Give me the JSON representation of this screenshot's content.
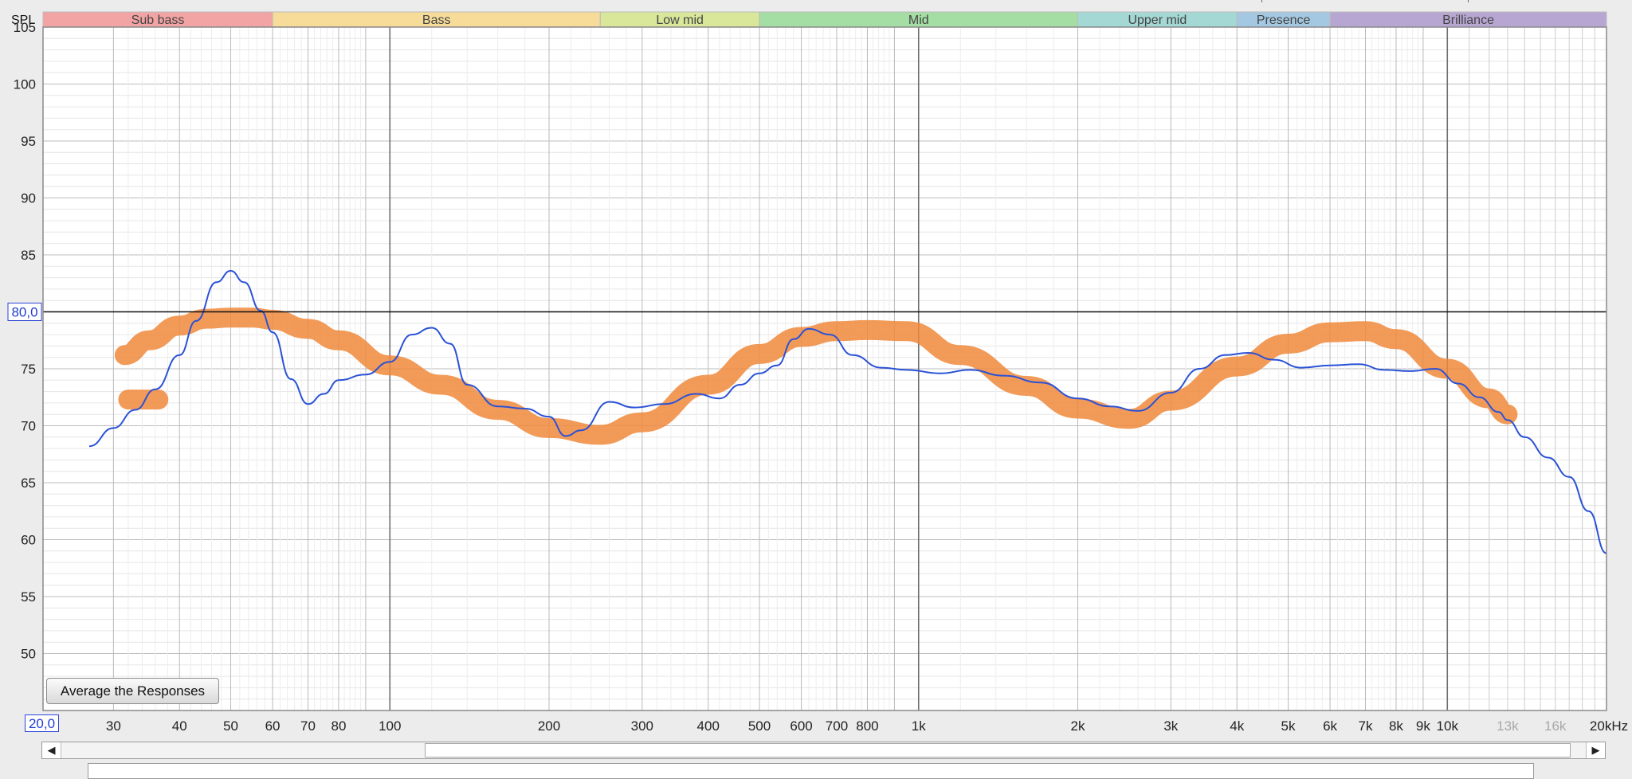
{
  "chart_data": {
    "type": "line",
    "title": "",
    "xlabel": "kHz",
    "ylabel": "SPL",
    "x_scale": "log",
    "xlim": [
      20,
      20000
    ],
    "ylim": [
      45,
      105
    ],
    "y_ticks": [
      50,
      55,
      60,
      65,
      70,
      75,
      80,
      85,
      90,
      95,
      100,
      105
    ],
    "x_ticks": [
      {
        "value": 30,
        "label": "30"
      },
      {
        "value": 40,
        "label": "40"
      },
      {
        "value": 50,
        "label": "50"
      },
      {
        "value": 60,
        "label": "60"
      },
      {
        "value": 70,
        "label": "70"
      },
      {
        "value": 80,
        "label": "80"
      },
      {
        "value": 100,
        "label": "100"
      },
      {
        "value": 200,
        "label": "200"
      },
      {
        "value": 300,
        "label": "300"
      },
      {
        "value": 400,
        "label": "400"
      },
      {
        "value": 500,
        "label": "500"
      },
      {
        "value": 600,
        "label": "600"
      },
      {
        "value": 700,
        "label": "700"
      },
      {
        "value": 800,
        "label": "800"
      },
      {
        "value": 1000,
        "label": "1k"
      },
      {
        "value": 2000,
        "label": "2k"
      },
      {
        "value": 3000,
        "label": "3k"
      },
      {
        "value": 4000,
        "label": "4k"
      },
      {
        "value": 5000,
        "label": "5k"
      },
      {
        "value": 6000,
        "label": "6k"
      },
      {
        "value": 7000,
        "label": "7k"
      },
      {
        "value": 8000,
        "label": "8k"
      },
      {
        "value": 9000,
        "label": "9k"
      },
      {
        "value": 10000,
        "label": "10k"
      },
      {
        "value": 13000,
        "label": "13k",
        "dim": true
      },
      {
        "value": 16000,
        "label": "16k",
        "dim": true
      },
      {
        "value": 20000,
        "label": "20kHz"
      }
    ],
    "bands": [
      {
        "name": "Sub bass",
        "from": 20,
        "to": 60,
        "color": "#f2a3a3"
      },
      {
        "name": "Bass",
        "from": 60,
        "to": 250,
        "color": "#f6dc98"
      },
      {
        "name": "Low mid",
        "from": 250,
        "to": 500,
        "color": "#d8e79a"
      },
      {
        "name": "Mid",
        "from": 500,
        "to": 2000,
        "color": "#a4dea4"
      },
      {
        "name": "Upper mid",
        "from": 2000,
        "to": 4000,
        "color": "#a4d8d4"
      },
      {
        "name": "Presence",
        "from": 4000,
        "to": 6000,
        "color": "#a4c8e2"
      },
      {
        "name": "Brilliance",
        "from": 6000,
        "to": 20000,
        "color": "#b8a6d2"
      }
    ],
    "cursor": {
      "y": 80.0,
      "y_label": "80,0",
      "x_label": "20,0"
    },
    "series": [
      {
        "kind": "band",
        "color": "#f08a3c",
        "x": [
          31.5,
          35,
          40,
          45,
          50,
          55,
          60,
          70,
          80,
          100,
          125,
          160,
          200,
          250,
          300,
          400,
          500,
          600,
          700,
          800,
          950,
          1200,
          1600,
          2000,
          2500,
          3000,
          4000,
          5000,
          6000,
          7000,
          8000,
          10000,
          12000,
          13000
        ],
        "y": [
          76.2,
          77.5,
          78.8,
          79.4,
          79.5,
          79.5,
          79.3,
          78.5,
          77.5,
          75.3,
          73.6,
          71.4,
          69.8,
          69.2,
          70.3,
          73.6,
          76.3,
          77.8,
          78.3,
          78.4,
          78.3,
          76.2,
          73.5,
          71.5,
          70.6,
          72.2,
          75.2,
          77.2,
          78.2,
          78.3,
          77.6,
          75.0,
          72.4,
          71.0
        ]
      },
      {
        "kind": "band",
        "color": "#f08a3c",
        "x": [
          32,
          36.5
        ],
        "y": [
          72.3,
          72.3
        ]
      },
      {
        "kind": "line",
        "color": "#2a52d6",
        "x": [
          27,
          30,
          33,
          36,
          40,
          43,
          47,
          50,
          53,
          57,
          60,
          65,
          70,
          75,
          80,
          90,
          100,
          110,
          120,
          130,
          140,
          160,
          180,
          200,
          215,
          230,
          260,
          290,
          330,
          380,
          420,
          460,
          500,
          540,
          580,
          620,
          680,
          750,
          850,
          950,
          1100,
          1250,
          1450,
          1700,
          2000,
          2300,
          2600,
          3000,
          3400,
          3800,
          4200,
          4700,
          5300,
          6000,
          6800,
          7600,
          8500,
          9500,
          10500,
          11500,
          12500,
          13000,
          14000,
          15500,
          17000,
          18500,
          20000
        ],
        "y": [
          68.2,
          69.8,
          71.4,
          73.2,
          76.2,
          79.2,
          82.6,
          83.6,
          82.6,
          80.1,
          78.2,
          74.1,
          71.9,
          72.8,
          74.0,
          74.5,
          75.6,
          78.0,
          78.6,
          77.2,
          73.6,
          71.7,
          71.5,
          70.8,
          69.1,
          69.6,
          72.1,
          71.6,
          71.9,
          72.8,
          72.4,
          73.6,
          74.6,
          75.3,
          77.6,
          78.5,
          78.0,
          76.2,
          75.1,
          74.9,
          74.6,
          74.9,
          74.4,
          73.8,
          72.4,
          71.7,
          71.3,
          72.9,
          75.0,
          76.2,
          76.4,
          75.8,
          75.1,
          75.3,
          75.4,
          74.9,
          74.8,
          75.0,
          73.7,
          72.5,
          71.2,
          70.5,
          69.0,
          67.2,
          65.5,
          62.5,
          58.8
        ]
      }
    ]
  },
  "ui": {
    "average_button_label": "Average the Responses",
    "scroll_left_glyph": "◀",
    "scroll_right_glyph": "▶"
  }
}
